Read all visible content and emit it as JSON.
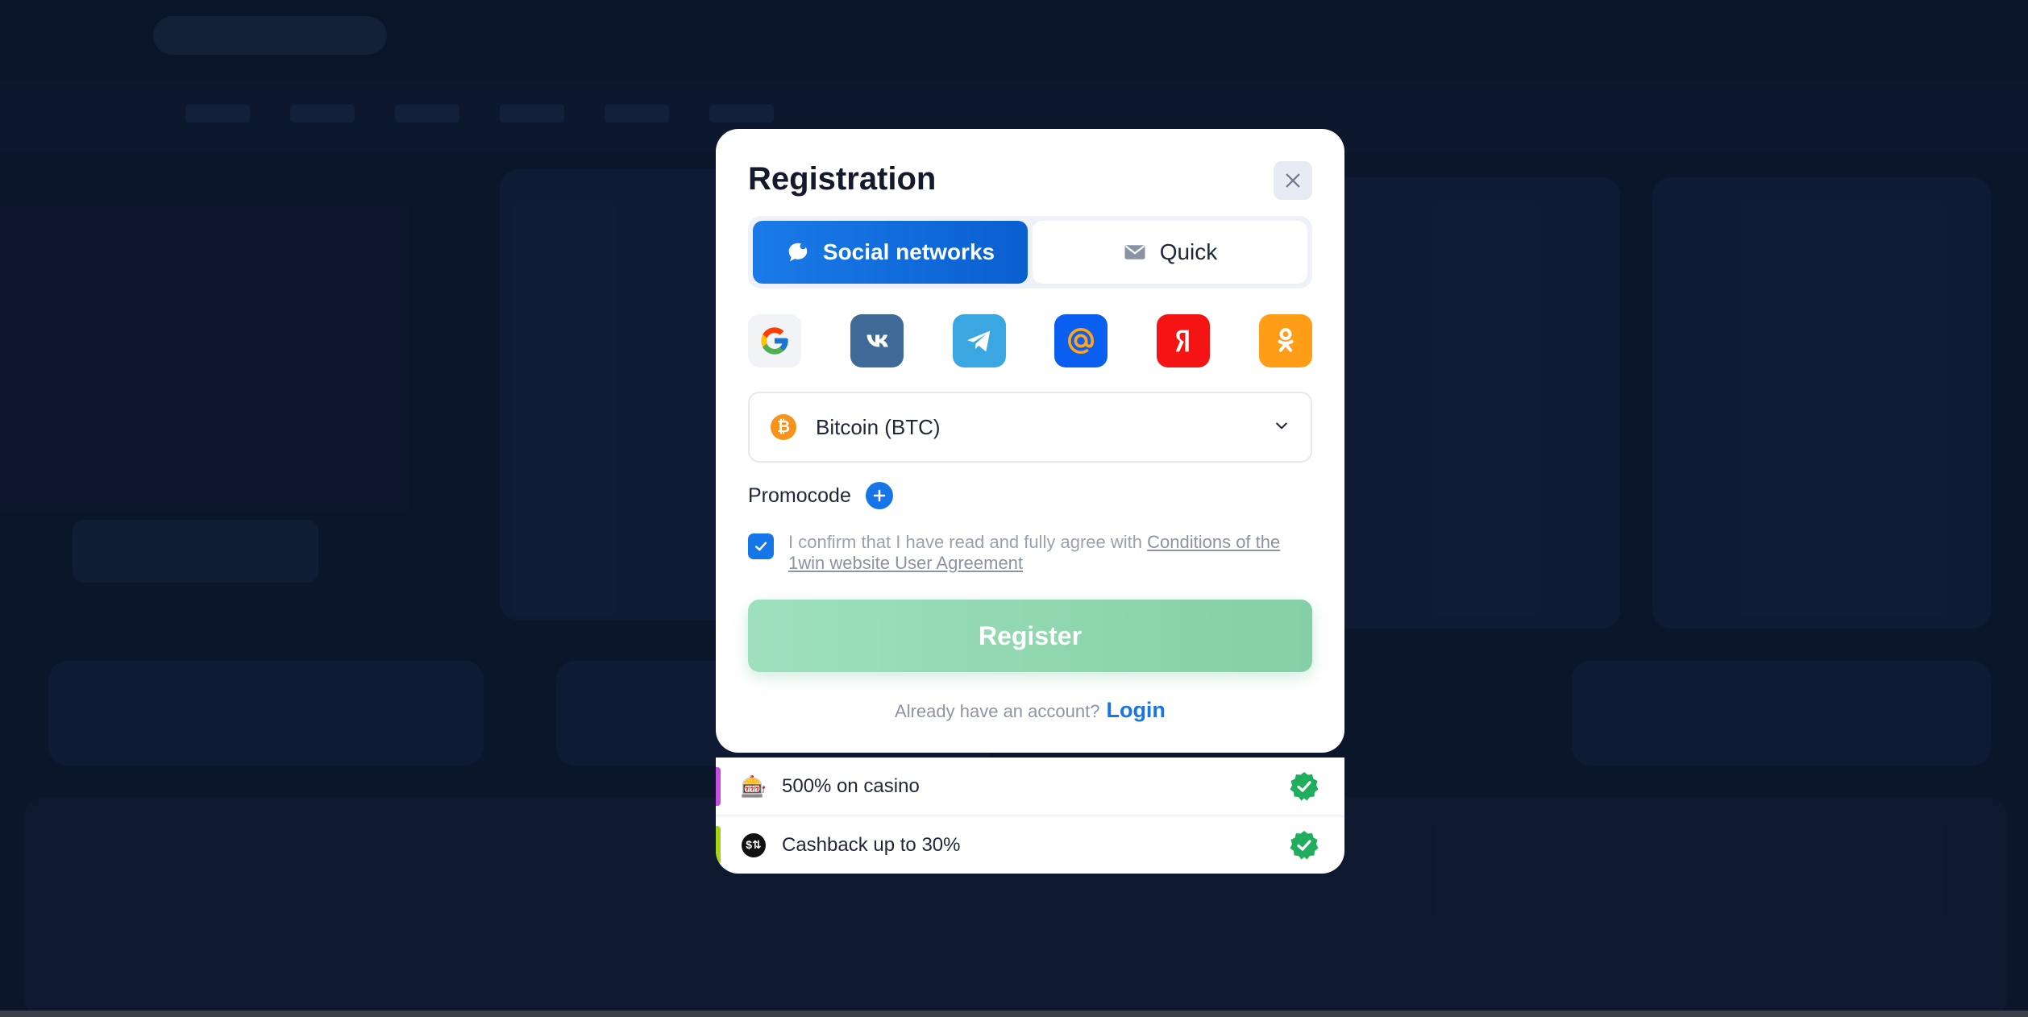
{
  "modal": {
    "title": "Registration",
    "tabs": [
      {
        "label": "Social networks",
        "icon": "chat-bubble-icon",
        "active": true
      },
      {
        "label": "Quick",
        "icon": "envelope-icon",
        "active": false
      }
    ],
    "socials": [
      {
        "name": "google",
        "icon": "google-icon",
        "color": "#f1f3f6"
      },
      {
        "name": "vk",
        "icon": "vk-icon",
        "color": "#3f6a98"
      },
      {
        "name": "telegram",
        "icon": "telegram-icon",
        "color": "#3aa6e2"
      },
      {
        "name": "mail",
        "icon": "at-sign-icon",
        "color": "#0a5ff0"
      },
      {
        "name": "yandex",
        "icon": "yandex-icon",
        "color": "#f51414"
      },
      {
        "name": "odnoklassniki",
        "icon": "ok-icon",
        "color": "#ff9d16"
      }
    ],
    "currency": {
      "value": "Bitcoin (BTC)",
      "icon": "bitcoin-icon"
    },
    "promocode_label": "Promocode",
    "agreement": {
      "text": "I confirm that I have read and fully agree with ",
      "link": "Conditions of the 1win website User Agreement",
      "checked": true
    },
    "register_label": "Register",
    "login_question": "Already have an account?",
    "login_link": "Login"
  },
  "bonuses": [
    {
      "text": "500% on casino",
      "icon": "slot-machine-icon",
      "accent": "#c44fe0",
      "included": true
    },
    {
      "text": "Cashback up to 30%",
      "icon": "cashback-coin-icon",
      "accent": "#a6d21a",
      "included": true
    }
  ],
  "colors": {
    "primary": "#1676e8",
    "register": "#9ee0bd",
    "check_badge": "#1fae5b"
  }
}
